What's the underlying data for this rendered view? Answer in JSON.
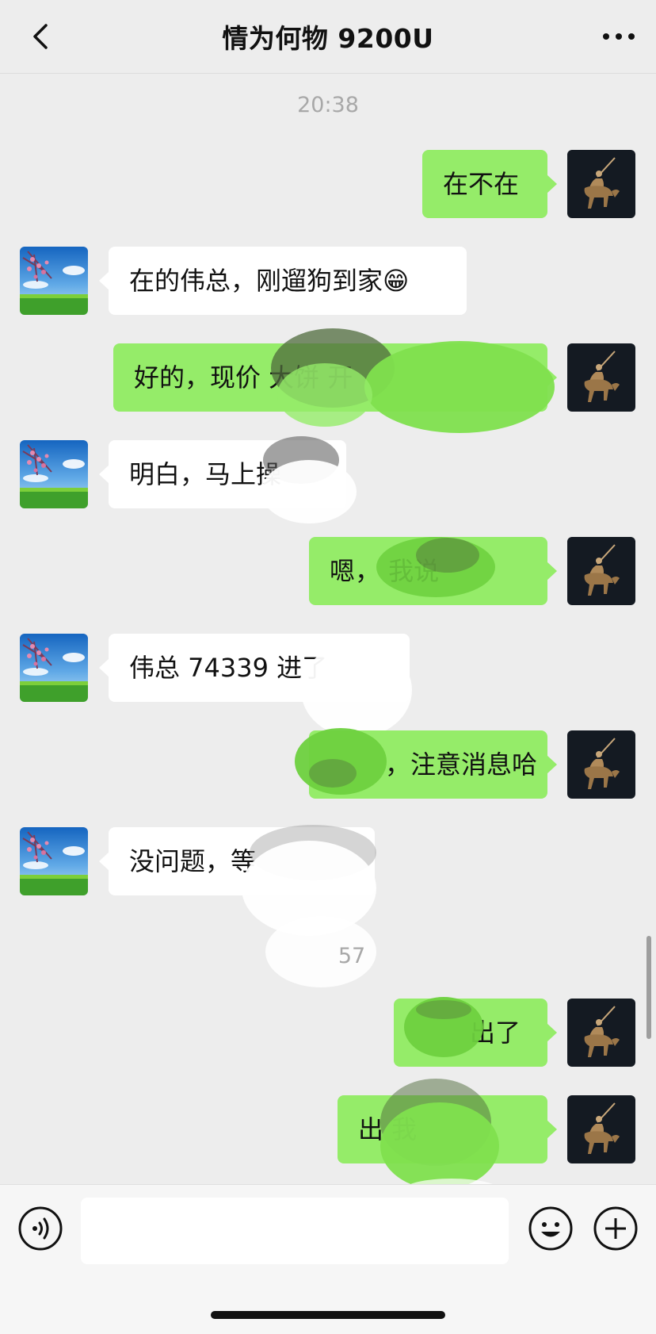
{
  "header": {
    "title": "情为何物 9200U",
    "back_icon": "chevron-left-icon",
    "more_icon": "more-dots-icon"
  },
  "timestamps": [
    "20:38",
    "57"
  ],
  "messages": [
    {
      "side": "out",
      "text": "在不在"
    },
    {
      "side": "in",
      "text": "在的伟总，刚遛狗到家😁"
    },
    {
      "side": "out",
      "text": "好的，现价 大饼 开"
    },
    {
      "side": "in",
      "text": "明白，马上操"
    },
    {
      "side": "out",
      "text": "嗯， 我说"
    },
    {
      "side": "in",
      "text": "伟总 74339 进了"
    },
    {
      "side": "out",
      "text": "，注意消息哈"
    },
    {
      "side": "in",
      "text": "没问题，等"
    },
    {
      "side": "out",
      "text": "出了"
    },
    {
      "side": "out",
      "text": "出 我"
    }
  ],
  "input_bar": {
    "voice_icon": "voice-icon",
    "input_value": "",
    "emoji_icon": "emoji-icon",
    "plus_icon": "plus-icon"
  },
  "colors": {
    "background": "#ededed",
    "outgoing_bubble": "#95ec69",
    "incoming_bubble": "#ffffff"
  }
}
